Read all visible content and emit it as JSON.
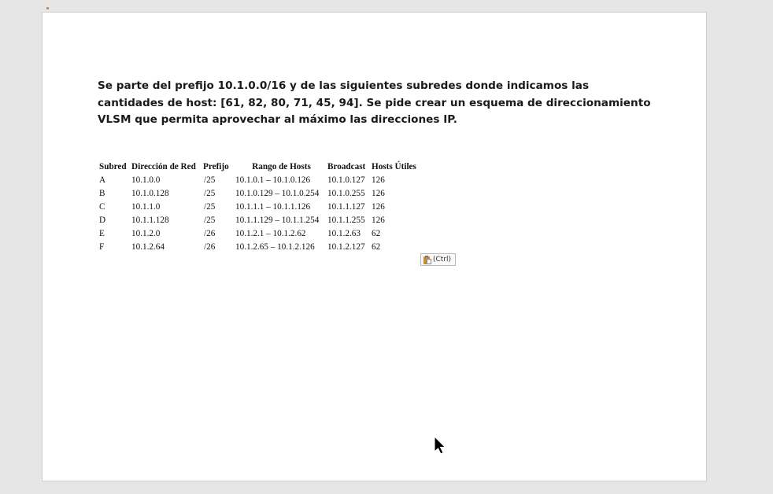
{
  "problem_text": "Se parte del prefijo 10.1.0.0/16 y de las siguientes subredes donde indicamos las cantidades de host: [61, 82, 80, 71, 45, 94]. Se pide crear un esquema de direccionamiento VLSM que permita aprovechar al máximo las direcciones IP.",
  "table": {
    "headers": [
      "Subred",
      "Dirección de Red",
      "Prefijo",
      "Rango de Hosts",
      "Broadcast",
      "Hosts Útiles"
    ],
    "rows": [
      [
        "A",
        "10.1.0.0",
        "/25",
        "10.1.0.1 – 10.1.0.126",
        "10.1.0.127",
        "126"
      ],
      [
        "B",
        "10.1.0.128",
        "/25",
        "10.1.0.129 – 10.1.0.254",
        "10.1.0.255",
        "126"
      ],
      [
        "C",
        "10.1.1.0",
        "/25",
        "10.1.1.1 – 10.1.1.126",
        "10.1.1.127",
        "126"
      ],
      [
        "D",
        "10.1.1.128",
        "/25",
        "10.1.1.129 – 10.1.1.254",
        "10.1.1.255",
        "126"
      ],
      [
        "E",
        "10.1.2.0",
        "/26",
        "10.1.2.1 – 10.1.2.62",
        "10.1.2.63",
        "62"
      ],
      [
        "F",
        "10.1.2.64",
        "/26",
        "10.1.2.65 – 10.1.2.126",
        "10.1.2.127",
        "62"
      ]
    ]
  },
  "paste_options": {
    "label": "(Ctrl)",
    "icon": "clipboard-paste-icon"
  },
  "colors": {
    "background": "#e6e6e6",
    "page": "#ffffff",
    "text": "#111111"
  }
}
